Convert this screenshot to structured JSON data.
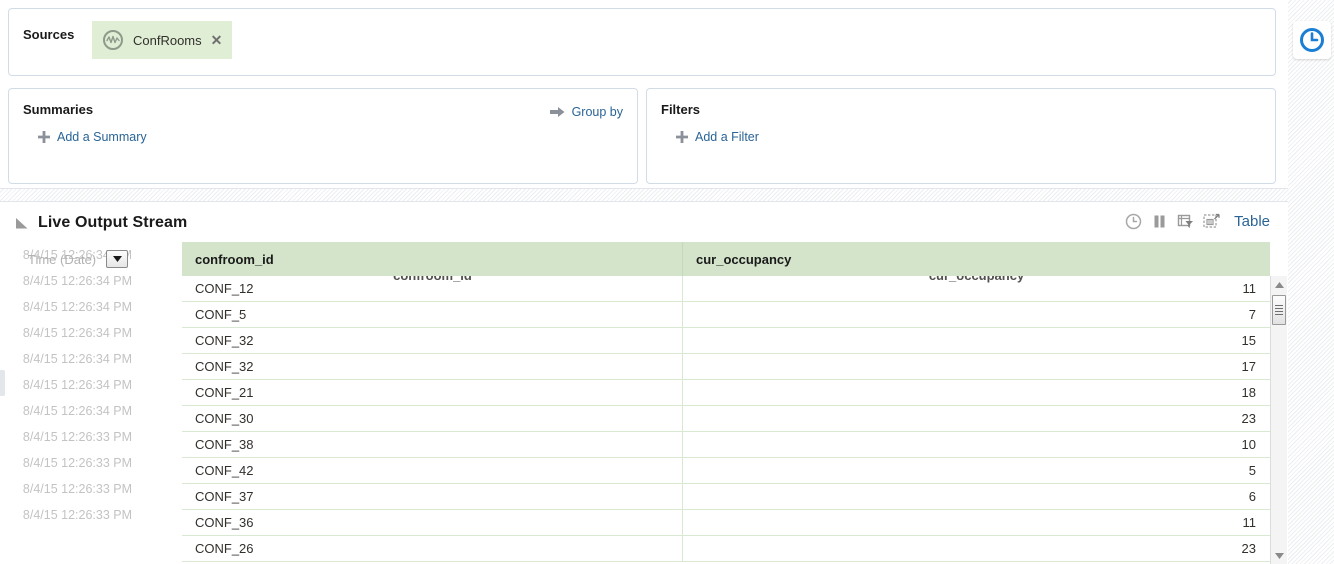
{
  "sources": {
    "title": "Sources",
    "chips": [
      {
        "label": "ConfRooms",
        "icon": "stream-source-icon",
        "close": "✕"
      }
    ]
  },
  "summaries": {
    "title": "Summaries",
    "add_label": "Add a Summary",
    "group_by_label": "Group by"
  },
  "filters": {
    "title": "Filters",
    "add_label": "Add a Filter"
  },
  "output": {
    "title": "Live Output Stream",
    "view_label": "Table",
    "tools": [
      {
        "name": "clock-icon"
      },
      {
        "name": "pause-icon"
      },
      {
        "name": "column-filter-icon"
      },
      {
        "name": "expand-icon"
      }
    ],
    "time_column": {
      "label": "Time (Date)",
      "dropdown_glyph": "▼"
    },
    "columns": [
      {
        "key": "confroom_id",
        "label": "confroom_id",
        "align": "left"
      },
      {
        "key": "cur_occupancy",
        "label": "cur_occupancy",
        "align": "right"
      }
    ],
    "rows": [
      {
        "time": "8/4/15 12:26:34 PM",
        "confroom_id": "CONF_12",
        "cur_occupancy": "11"
      },
      {
        "time": "8/4/15 12:26:34 PM",
        "confroom_id": "CONF_5",
        "cur_occupancy": "7"
      },
      {
        "time": "8/4/15 12:26:34 PM",
        "confroom_id": "CONF_32",
        "cur_occupancy": "15"
      },
      {
        "time": "8/4/15 12:26:34 PM",
        "confroom_id": "CONF_32",
        "cur_occupancy": "17"
      },
      {
        "time": "8/4/15 12:26:34 PM",
        "confroom_id": "CONF_21",
        "cur_occupancy": "18"
      },
      {
        "time": "8/4/15 12:26:34 PM",
        "confroom_id": "CONF_30",
        "cur_occupancy": "23"
      },
      {
        "time": "8/4/15 12:26:34 PM",
        "confroom_id": "CONF_38",
        "cur_occupancy": "10"
      },
      {
        "time": "8/4/15 12:26:33 PM",
        "confroom_id": "CONF_42",
        "cur_occupancy": "5"
      },
      {
        "time": "8/4/15 12:26:33 PM",
        "confroom_id": "CONF_37",
        "cur_occupancy": "6"
      },
      {
        "time": "8/4/15 12:26:33 PM",
        "confroom_id": "CONF_36",
        "cur_occupancy": "11"
      },
      {
        "time": "8/4/15 12:26:33 PM",
        "confroom_id": "CONF_26",
        "cur_occupancy": "23"
      }
    ]
  },
  "right_rail": {
    "widgets": [
      {
        "name": "clock-widget-icon"
      }
    ]
  },
  "colors": {
    "header_green": "#d3e4ca",
    "chip_green": "#dfeed5",
    "link_blue": "#2a6496",
    "accent_blue": "#1a7fd4",
    "muted_text": "#c3c3c3",
    "panel_border": "#d2dce6"
  }
}
